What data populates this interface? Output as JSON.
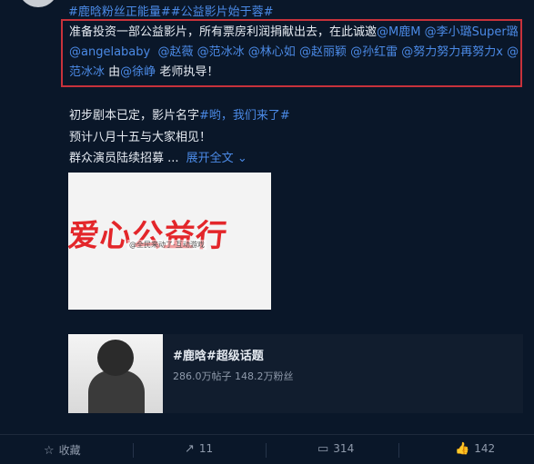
{
  "post": {
    "tag_line": "#鹿晗粉丝正能量##公益影片始于蓉#",
    "highlight": {
      "t1": "准备投资一部公益影片，所有票房利润捐献出去，在此诚邀",
      "m1": "@M鹿M",
      "m2": "@李小璐Super璐",
      "m3": "@angelababy",
      "m4": "@赵薇",
      "m5": "@范冰冰",
      "m6": "@林心如",
      "m7": "@赵丽颖",
      "m8": "@孙红雷",
      "m9": "@努力努力再努力x",
      "m10": "@范冰冰",
      "t2": "由",
      "m11": "@徐峥",
      "t3": "老师执导！"
    },
    "line2_text": "初步剧本已定，影片名字",
    "line2_tag": "#哟，我们来了#",
    "line3": "预计八月十五与大家相见！",
    "line4": "群众演员陆续招募 ...",
    "expand_label": "展开全文",
    "expand_icon": "chevron-down"
  },
  "media": {
    "banner_text": "爱心公益行",
    "watermark": "@全民来动了-互动游戏"
  },
  "topic_card": {
    "title": "#鹿晗#超级话题",
    "stats": "286.0万帖子 148.2万粉丝"
  },
  "actions": {
    "favorite": "收藏",
    "repost": "11",
    "comment": "314",
    "like": "142"
  },
  "colors": {
    "background": "#0a1729",
    "link": "#4b8ae6",
    "highlight_border": "#c8323b",
    "banner_red": "#e3262a"
  }
}
